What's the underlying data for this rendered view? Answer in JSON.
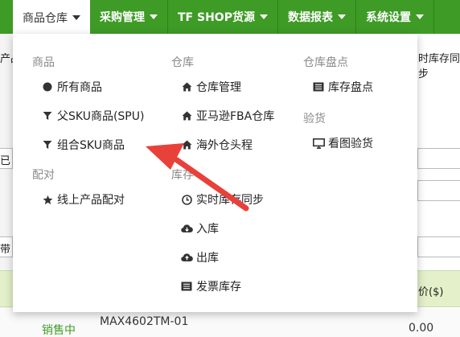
{
  "nav": {
    "items": [
      {
        "label": "商品仓库",
        "active": true
      },
      {
        "label": "采购管理"
      },
      {
        "label": "TF SHOP货源"
      },
      {
        "label": "数据报表"
      },
      {
        "label": "系统设置"
      }
    ]
  },
  "background": {
    "left_fragment_1": "产品",
    "left_fragment_2": "已",
    "left_fragment_3": "带",
    "right_header": "时库存同步",
    "price_header": "价($)",
    "status": "销售中",
    "model": "MAX4602TM-01",
    "price": "0.00"
  },
  "menu": {
    "products": {
      "title": "商品",
      "items": [
        {
          "label": "所有商品",
          "icon": "circle-icon"
        },
        {
          "label": "父SKU商品(SPU)",
          "icon": "filter-icon"
        },
        {
          "label": "组合SKU商品",
          "icon": "filter-icon"
        }
      ]
    },
    "match": {
      "title": "配对",
      "items": [
        {
          "label": "线上产品配对",
          "icon": "star-icon"
        }
      ]
    },
    "warehouse": {
      "title": "仓库",
      "items": [
        {
          "label": "仓库管理",
          "icon": "home-icon"
        },
        {
          "label": "亚马逊FBA仓库",
          "icon": "home-icon"
        },
        {
          "label": "海外仓头程",
          "icon": "home-icon"
        }
      ]
    },
    "stock": {
      "title": "库存",
      "items": [
        {
          "label": "实时库存同步",
          "icon": "clock-icon"
        },
        {
          "label": "入库",
          "icon": "cloud-download-icon"
        },
        {
          "label": "出库",
          "icon": "cloud-upload-icon"
        },
        {
          "label": "发票库存",
          "icon": "list-icon"
        }
      ]
    },
    "inventory_check": {
      "title": "仓库盘点",
      "items": [
        {
          "label": "库存盘点",
          "icon": "list-icon"
        }
      ]
    },
    "inspection": {
      "title": "验货",
      "items": [
        {
          "label": "看图验货",
          "icon": "monitor-icon"
        }
      ]
    }
  },
  "colors": {
    "nav_green": "#3e9b26",
    "status_green": "#3e9b26",
    "arrow_red": "#e8413a"
  }
}
